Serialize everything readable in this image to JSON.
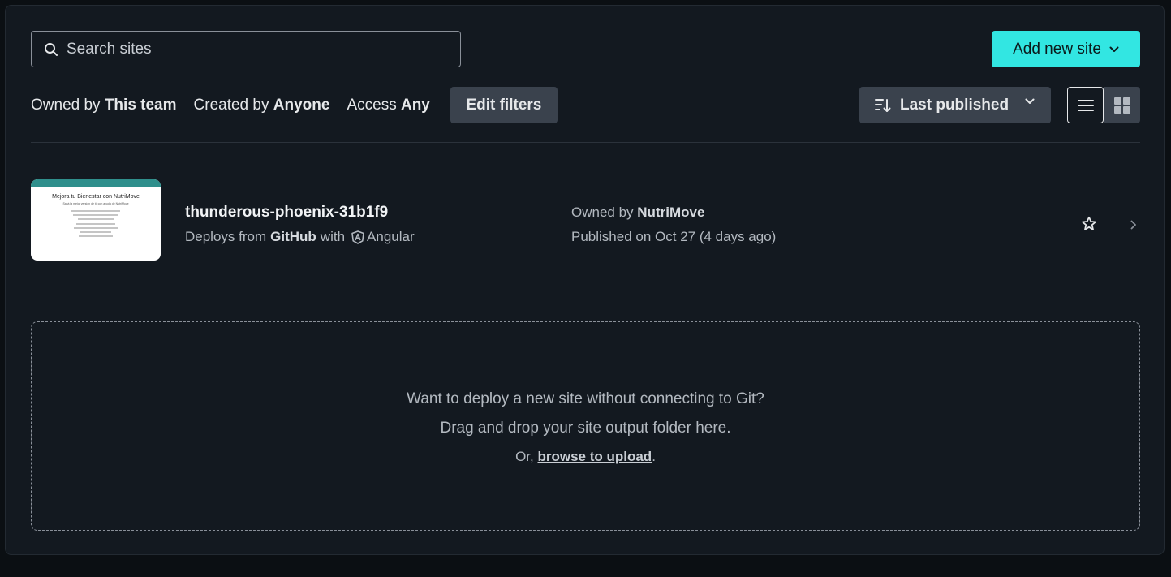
{
  "search": {
    "placeholder": "Search sites"
  },
  "add_site": {
    "label": "Add new site"
  },
  "filters": {
    "owned": {
      "prefix": "Owned by",
      "value": "This team"
    },
    "created": {
      "prefix": "Created by",
      "value": "Anyone"
    },
    "access": {
      "prefix": "Access",
      "value": "Any"
    },
    "edit_label": "Edit filters"
  },
  "sort": {
    "label": "Last published"
  },
  "sites": [
    {
      "name": "thunderous-phoenix-31b1f9",
      "deploy_prefix": "Deploys from",
      "deploy_source": "GitHub",
      "deploy_with": "with",
      "framework": "Angular",
      "owned_prefix": "Owned by",
      "owner": "NutriMove",
      "published": "Published on Oct 27 (4 days ago)",
      "thumbnail": {
        "title": "Mejora tu Bienestar con NutriMove",
        "subtitle": "Sacá la mejor versión de ti, con ayuda de NutriMove"
      }
    }
  ],
  "dropzone": {
    "line1": "Want to deploy a new site without connecting to Git?",
    "line2": "Drag and drop your site output folder here.",
    "line3_prefix": "Or,",
    "link": "browse to upload",
    "line3_suffix": "."
  },
  "colors": {
    "background": "#131920",
    "accent": "#32e6e2",
    "button": "#3a424d"
  }
}
